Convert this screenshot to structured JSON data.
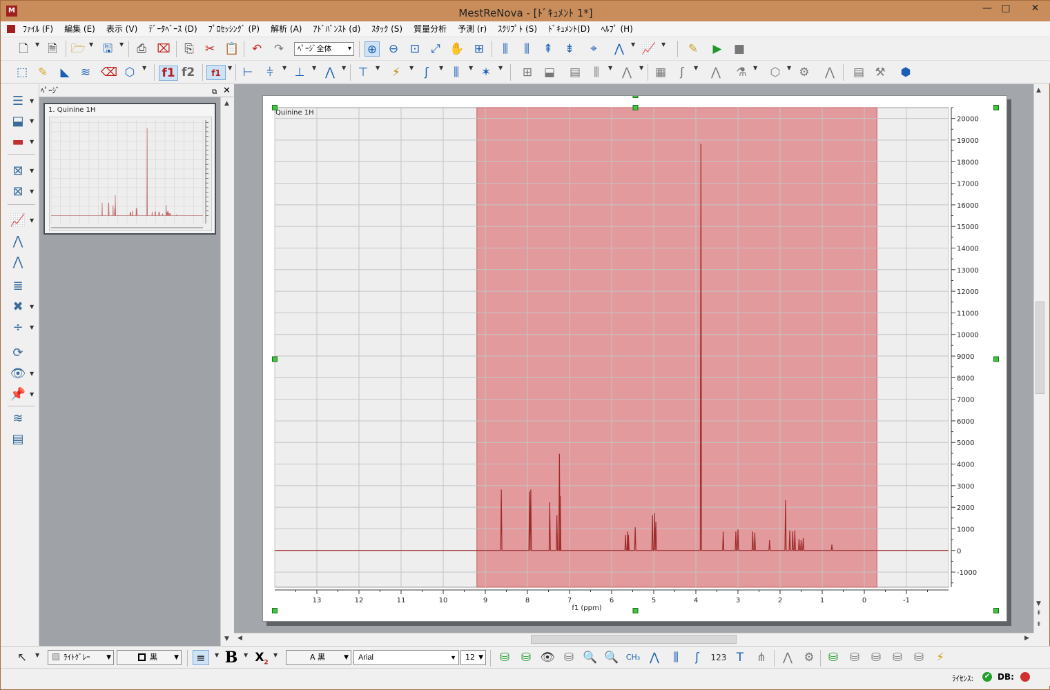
{
  "window": {
    "title": "MestReNova - [ﾄﾞｷｭﾒﾝﾄ 1*]",
    "minimize": "—",
    "restore": "□",
    "close": "✕"
  },
  "menu": {
    "items": [
      "ﾌｧｲﾙ (F)",
      "編集 (E)",
      "表示 (V)",
      "ﾃﾞｰﾀﾍﾞｰｽ (D)",
      "ﾌﾟﾛｾｯｼﾝｸﾞ (P)",
      "解析 (A)",
      "ｱﾄﾞﾊﾞﾝｽﾄ (d)",
      "ｽﾀｯｸ (S)",
      "質量分析",
      "予測 (r)",
      "ｽｸﾘﾌﾟﾄ (S)",
      "ﾄﾞｷｭﾒﾝﾄ(D)",
      "ﾍﾙﾌﾟ (H)"
    ]
  },
  "toolbar": {
    "zoom_select": "ﾍﾟｰｼﾞ全体",
    "f1": "f1",
    "f2": "f2",
    "fn": "f1"
  },
  "pages_panel": {
    "title": "ﾍﾟｰｼﾞ",
    "float": "⧉",
    "close": "✕",
    "thumb_title": "1. Quinine 1H"
  },
  "spectrum": {
    "label": "Quinine 1H",
    "xlabel": "f1 (ppm)",
    "x_ticks": [
      "13",
      "12",
      "11",
      "10",
      "9",
      "8",
      "7",
      "6",
      "5",
      "4",
      "3",
      "2",
      "1",
      "0",
      "-1"
    ],
    "y_ticks": [
      "20000",
      "19000",
      "18000",
      "17000",
      "16000",
      "15000",
      "14000",
      "13000",
      "12000",
      "11000",
      "10000",
      "9000",
      "8000",
      "7000",
      "6000",
      "5000",
      "4000",
      "3000",
      "2000",
      "1000",
      "0",
      "-1000"
    ],
    "line_color": "#9e2a2a",
    "highlight_color": "#e39a9d"
  },
  "chart_data": {
    "type": "line",
    "title": "Quinine 1H",
    "xlabel": "f1 (ppm)",
    "ylabel": "",
    "xlim": [
      14,
      -2
    ],
    "ylim": [
      -1700,
      20500
    ],
    "x_reversed": true,
    "grid": true,
    "highlight_region": [
      9.2,
      -0.3
    ],
    "peaks": [
      {
        "x": 8.62,
        "y": 2800
      },
      {
        "x": 7.95,
        "y": 2700
      },
      {
        "x": 7.92,
        "y": 2800
      },
      {
        "x": 7.47,
        "y": 2200
      },
      {
        "x": 7.3,
        "y": 1600
      },
      {
        "x": 7.24,
        "y": 4450
      },
      {
        "x": 7.22,
        "y": 2500
      },
      {
        "x": 5.67,
        "y": 700
      },
      {
        "x": 5.62,
        "y": 850
      },
      {
        "x": 5.6,
        "y": 700
      },
      {
        "x": 5.44,
        "y": 1050
      },
      {
        "x": 5.03,
        "y": 1600
      },
      {
        "x": 4.98,
        "y": 1700
      },
      {
        "x": 4.95,
        "y": 1300
      },
      {
        "x": 3.88,
        "y": 18800
      },
      {
        "x": 3.35,
        "y": 850
      },
      {
        "x": 3.05,
        "y": 850
      },
      {
        "x": 3.0,
        "y": 950
      },
      {
        "x": 2.65,
        "y": 850
      },
      {
        "x": 2.6,
        "y": 800
      },
      {
        "x": 2.25,
        "y": 450
      },
      {
        "x": 1.87,
        "y": 2300
      },
      {
        "x": 1.77,
        "y": 900
      },
      {
        "x": 1.7,
        "y": 850
      },
      {
        "x": 1.65,
        "y": 900
      },
      {
        "x": 1.55,
        "y": 500
      },
      {
        "x": 1.5,
        "y": 450
      },
      {
        "x": 1.45,
        "y": 550
      },
      {
        "x": 0.77,
        "y": 250
      }
    ]
  },
  "bottombar": {
    "fill": "ﾗｲﾄｸﾞﾚｰ",
    "line": "黒",
    "text_color": "A 黒",
    "font": "Arial",
    "size": "12"
  },
  "status": {
    "license": "ﾗｲｾﾝｽ:",
    "db": "DB:"
  }
}
